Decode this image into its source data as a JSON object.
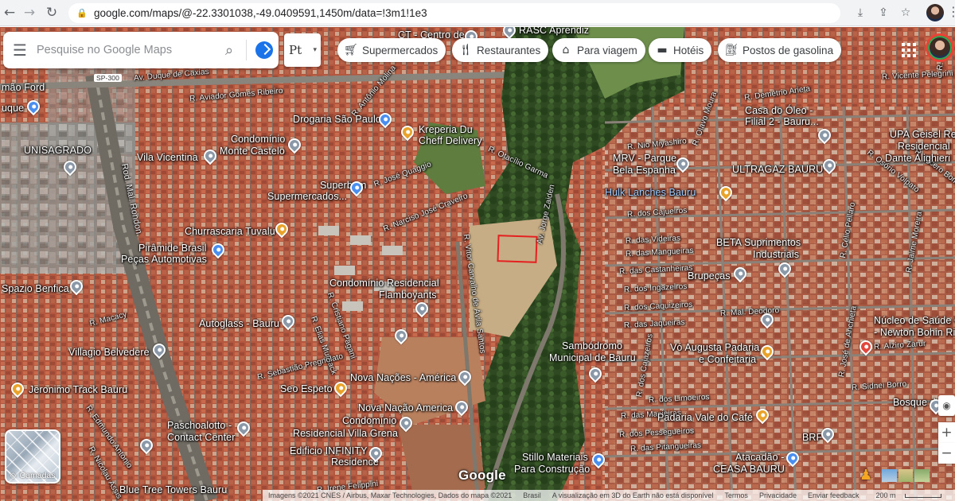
{
  "browser": {
    "url": "google.com/maps/@-22.3301038,-49.0409591,1450m/data=!3m1!1e3",
    "back_icon": "arrow-left-icon",
    "forward_icon": "arrow-right-icon",
    "reload_icon": "reload-icon"
  },
  "search": {
    "placeholder": "Pesquise no Google Maps"
  },
  "language_button": {
    "label": "Pt"
  },
  "chips": [
    {
      "label": "Supermercados",
      "icon": "cart-icon"
    },
    {
      "label": "Restaurantes",
      "icon": "fork-knife-icon"
    },
    {
      "label": "Para viagem",
      "icon": "takeout-icon"
    },
    {
      "label": "Hotéis",
      "icon": "bed-icon"
    },
    {
      "label": "Postos de gasolina",
      "icon": "gas-station-icon"
    }
  ],
  "map": {
    "labels": {
      "mao_ford": "mão Ford",
      "rque": "uque",
      "unisagrado": "UNISAGRADO",
      "vila_vicentina": "Vila Vicentina",
      "condominio_monte_castelo_1": "Condomínio",
      "condominio_monte_castelo_2": "Monte Castelo",
      "drogaria": "Drogaria São Paulo",
      "kreperia_1": "Kreperia Du",
      "kreperia_2": "Cheff Delivery",
      "superbom_1": "Superbom",
      "superbom_2": "Supermercados...",
      "churrascaria": "Churrascaria Tuvalu",
      "piramide_1": "Pirâmide Brasil",
      "piramide_2": "Peças Automotivas",
      "spazio": "Spazio Benfica",
      "cond_flamboyants_1": "Condomínio Residencial",
      "cond_flamboyants_2": "Flamboyants",
      "autoglass": "Autoglass - Bauru",
      "villagio": "Villagio Belvedere",
      "jeronimo": "Jeronimo Track Bauru",
      "seo_espeto": "Seo Espeto",
      "nova_nacoes": "Nova Nações - América",
      "nova_nacao": "Nova Nação America",
      "paschoalotto_1": "Paschoalotto -",
      "paschoalotto_2": "Contact Center",
      "villa_grena_1": "Condomínio",
      "villa_grena_2": "Residencial Villa Grena",
      "infinity_1": "Edificio INFINITY",
      "infinity_2": "Residence",
      "blue_tree": "Blue Tree Towers Bauru",
      "ct_centro": "CT - Centro de",
      "rasc": "RASC Aprendiz",
      "mrv_1": "MRV - Parque",
      "mrv_2": "Bela Espanha",
      "ultragaz": "ULTRAGAZ BAURU",
      "hulk": "Hulk Lanches Bauru",
      "casa_oleo_1": "Casa do Óleo -",
      "casa_oleo_2": "Filial 2 - Bauru...",
      "upa_1": "UPA Geisel Re",
      "upa_2": "Residencial",
      "upa_3": "Dante Alighieri",
      "beta_1": "BETA Suprimentos",
      "beta_2": "Industriais",
      "brupecas": "Brupeças",
      "sambodromo_1": "Sambódromo",
      "sambodromo_2": "Municipal de Bauru",
      "vo_augusta_1": "Vó Augusta Padaria",
      "vo_augusta_2": "e Confeitaria",
      "nucleo_1": "Núcleo de Saúde Geise",
      "nucleo_2": "- Newton Bohin Ribeiro",
      "bosque": "Bosque do G",
      "padaria_vale": "Padaria Vale do Café",
      "brf": "BRF",
      "stillo_1": "Stillo Materiais",
      "stillo_2": "Para Construção",
      "atacadao_1": "Atacadão -",
      "atacadao_2": "CEASA BAURU"
    },
    "streets": {
      "sp300": "SP-300",
      "duque": "Av. Duque de Caxias",
      "aviador": "R. Aviador Gomes Ribeiro",
      "antonio_molina": "R. Antônio Molina",
      "otacilio": "R. Otacílio Garma",
      "jose_quaggio": "R. José Quaggio",
      "narciso": "R. Narciso José Craveiro",
      "jorge_zaiden": "Av. Jorge Zaiden",
      "vitor": "R. Vitor Carvalho de Ávila Santos",
      "rod_mal": "Rod. Mal. Rondon",
      "macaci": "R. Macacy",
      "elias": "R. Elias Murback",
      "cristiano": "R. Cristiano Pagani",
      "sebastiao": "R. Sebastião Pregnolato",
      "edmundo": "R. Edmundo Antonio",
      "nicolau": "R. Nicolau Assis",
      "irene": "R. Irene Felippini",
      "nio": "R. Nio Miyashiro",
      "olavo": "R. Olavo Moura",
      "cajueiros": "R. dos Cajueiros",
      "videiras": "R. das Videiras",
      "mangueiras": "R. das Mangueiras",
      "castanheiras": "R. das Castanheiras",
      "ingazeiros": "R. dos Ingazeiros",
      "caquizeiros": "R. dos Caquizeiros",
      "jaqueiras": "R. das Jaqueiras",
      "mal_deodoro": "R. Mal. Deodoro",
      "cajazeiros": "R. dos Cajazeiros",
      "limoeiros": "R. dos Limoeiros",
      "macieiras": "R. das Macieiras",
      "pessegueiros": "R. dos Pessegueiros",
      "pitangueiras": "R. das Pitangueiras",
      "demetrio": "R. Demétrio Arieta",
      "vicente": "R. Vicente Pelegrini Savastano",
      "alziro": "R. Alziro Zarur",
      "sidnei": "R. Sidnei Borro",
      "jose_anchieta": "R. José de Anchieta",
      "celio": "R. Célio Pellaro",
      "osorio": "R. Osório Volpato",
      "cicero": "R. Cícero Bom Bosco",
      "jaime": "R. Jaime Moreira",
      "maria": "R. Maria"
    }
  },
  "layers_button": {
    "label": "Camadas"
  },
  "google_logo": "Google",
  "attribution": {
    "imagery": "Imagens ©2021 CNES / Airbus, Maxar Technologies, Dados do mapa ©2021",
    "country": "Brasil",
    "notice": "A visualização em 3D do Earth não está disponível",
    "terms": "Termos",
    "privacy": "Privacidade",
    "feedback": "Enviar feedback",
    "scale": "200 m"
  }
}
